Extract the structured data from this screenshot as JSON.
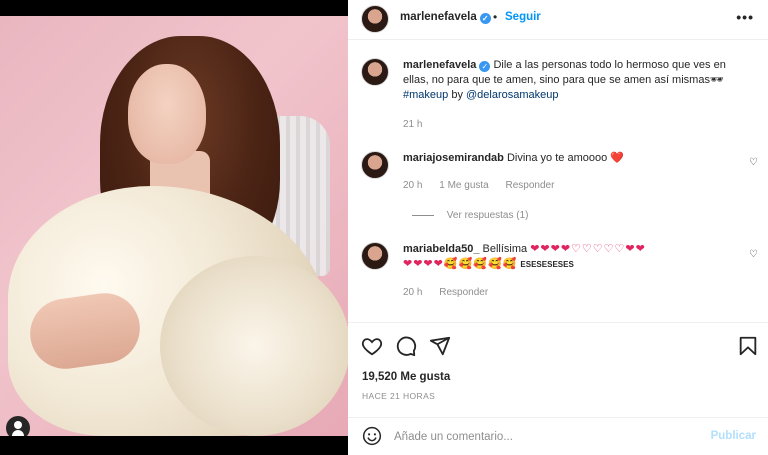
{
  "post": {
    "author": "marlenefavela",
    "follow_label": "Seguir",
    "separator": "•",
    "more_label": "•••",
    "caption": {
      "author": "marlenefavela",
      "text": "Dile a las personas todo lo hermoso que ves en ellas, no para que te amen, sino para que se amen así mismas🕶",
      "hashtag": "#makeup",
      "by": " by ",
      "mention": "@delarosamakeup",
      "time": "21 h"
    },
    "comments": [
      {
        "user": "mariajosemirandab",
        "text": "Divina yo te amoooo",
        "emoji": "❤️",
        "time": "20 h",
        "likes": "1 Me gusta",
        "reply_label": "Responder",
        "view_replies": "Ver respuestas (1)"
      },
      {
        "user": "mariabelda50_",
        "text": "Bellísima",
        "emojis_line1": "❤❤❤❤♡♡♡♡♡❤❤",
        "emojis_line2": "❤❤❤❤🥰🥰🥰🥰🥰",
        "suffix": "ESESESESES",
        "time": "20 h",
        "reply_label": "Responder"
      }
    ],
    "likes_count": "19,520 Me gusta",
    "time_ago": "HACE 21 HORAS",
    "comment_placeholder": "Añade un comentario...",
    "publish_label": "Publicar"
  },
  "icons": {
    "like": "heart-icon",
    "comment": "comment-icon",
    "share": "send-icon",
    "save": "bookmark-icon",
    "emoji": "smile-icon",
    "tag": "user-tag-icon"
  },
  "colors": {
    "accent": "#0095f6",
    "verified": "#3897f0",
    "heart": "#e0245e",
    "publish_disabled": "#b2dffc"
  }
}
